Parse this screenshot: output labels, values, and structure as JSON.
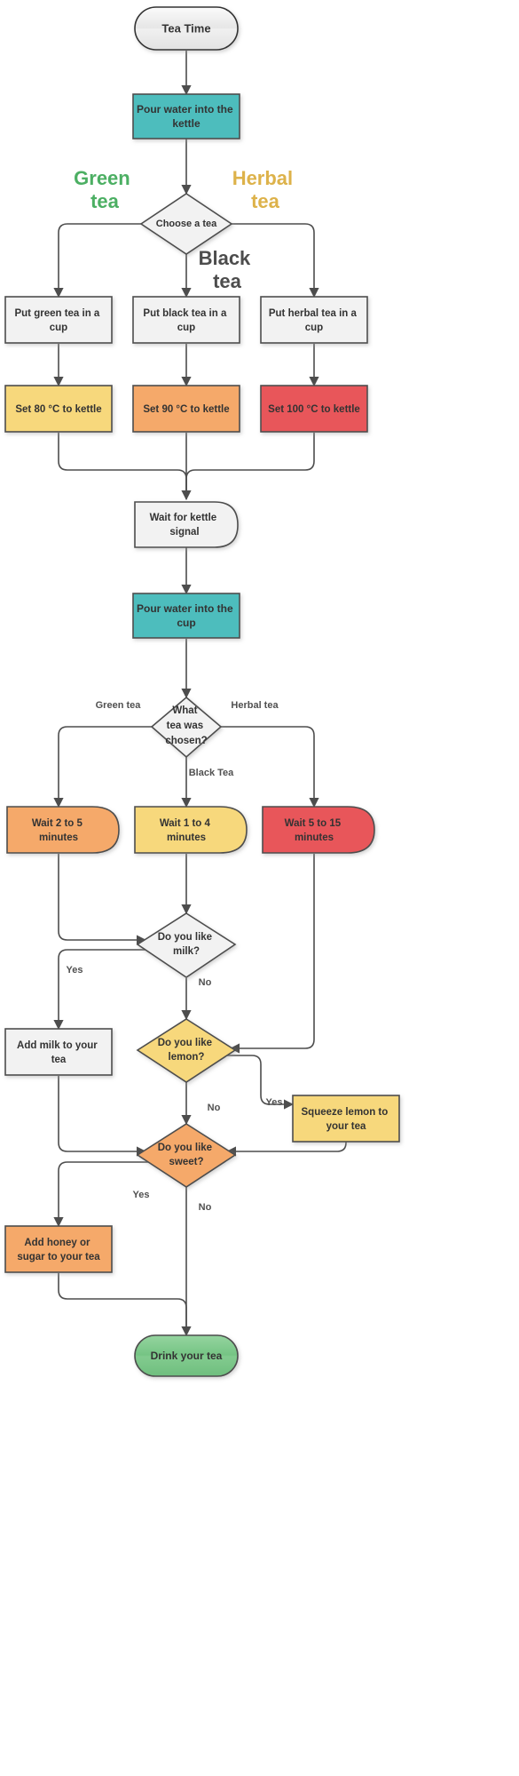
{
  "diagram": {
    "title": "Tea Time Flowchart",
    "type": "flowchart",
    "direction": "top-to-bottom"
  },
  "palette": {
    "default_fill": "#f2f2f2",
    "default_stroke": "#4d4d4d",
    "teal_fill": "#4dbdbd",
    "teal_stroke": "#00808a",
    "yellow_fill": "#f7d87c",
    "yellow_stroke": "#d4ab40",
    "orange_fill": "#f5a96b",
    "orange_stroke": "#d4813a",
    "red_fill": "#e8575a",
    "red_stroke": "#cc3a3e",
    "green_fill": "#7dc98a",
    "green_stroke": "#3f9e55",
    "text_color": "#333333",
    "green_label": "#4caf63",
    "herbal_label": "#ddb24a",
    "black_label": "#4d4d4d"
  },
  "nodes": {
    "start": {
      "label": "Tea Time",
      "shape": "stadium",
      "fill": "default"
    },
    "pour_kettle": {
      "label": "Pour water into the kettle",
      "shape": "rect",
      "fill": "teal"
    },
    "choose_tea": {
      "label": "Choose a tea",
      "shape": "diamond",
      "fill": "default"
    },
    "green_cup": {
      "label": "Put green tea in a cup",
      "shape": "rect",
      "fill": "default"
    },
    "black_cup": {
      "label": "Put black tea in a cup",
      "shape": "rect",
      "fill": "default"
    },
    "herbal_cup": {
      "label": "Put herbal tea in a cup",
      "shape": "rect",
      "fill": "default"
    },
    "set80": {
      "label": "Set 80 °C to kettle",
      "shape": "rect",
      "fill": "yellow"
    },
    "set90": {
      "label": "Set 90 °C to kettle",
      "shape": "rect",
      "fill": "orange"
    },
    "set100": {
      "label": "Set 100 °C to kettle",
      "shape": "rect",
      "fill": "red"
    },
    "wait_signal": {
      "label": "Wait for kettle signal",
      "shape": "flag",
      "fill": "default"
    },
    "pour_cup": {
      "label": "Pour water into the cup",
      "shape": "rect",
      "fill": "teal"
    },
    "what_tea": {
      "label": "What tea was chosen?",
      "shape": "diamond",
      "fill": "default"
    },
    "wait25": {
      "label": "Wait 2 to 5 minutes",
      "shape": "flag",
      "fill": "orange"
    },
    "wait14": {
      "label": "Wait 1 to 4 minutes",
      "shape": "flag",
      "fill": "yellow"
    },
    "wait515": {
      "label": "Wait 5 to 15 minutes",
      "shape": "flag",
      "fill": "red"
    },
    "like_milk": {
      "label": "Do you like milk?",
      "shape": "diamond",
      "fill": "default"
    },
    "add_milk": {
      "label": "Add milk to your tea",
      "shape": "rect",
      "fill": "default"
    },
    "like_lemon": {
      "label": "Do you like lemon?",
      "shape": "diamond",
      "fill": "yellow"
    },
    "squeeze_lemon": {
      "label": "Squeeze lemon to your tea",
      "shape": "rect",
      "fill": "yellow"
    },
    "like_sweet": {
      "label": "Do you like sweet?",
      "shape": "diamond",
      "fill": "orange"
    },
    "add_honey": {
      "label": "Add honey or sugar to your tea",
      "shape": "rect",
      "fill": "orange"
    },
    "drink": {
      "label": "Drink your tea",
      "shape": "stadium",
      "fill": "green"
    }
  },
  "edge_labels": {
    "green_tea_big": "Green tea",
    "herbal_tea_big": "Herbal tea",
    "black_tea_big": "Black tea",
    "green_tea_small": "Green tea",
    "herbal_tea_small": "Herbal tea",
    "black_tea_small": "Black Tea",
    "milk_yes": "Yes",
    "milk_no": "No",
    "lemon_yes": "Yes",
    "lemon_no": "No",
    "sweet_yes": "Yes",
    "sweet_no": "No"
  }
}
